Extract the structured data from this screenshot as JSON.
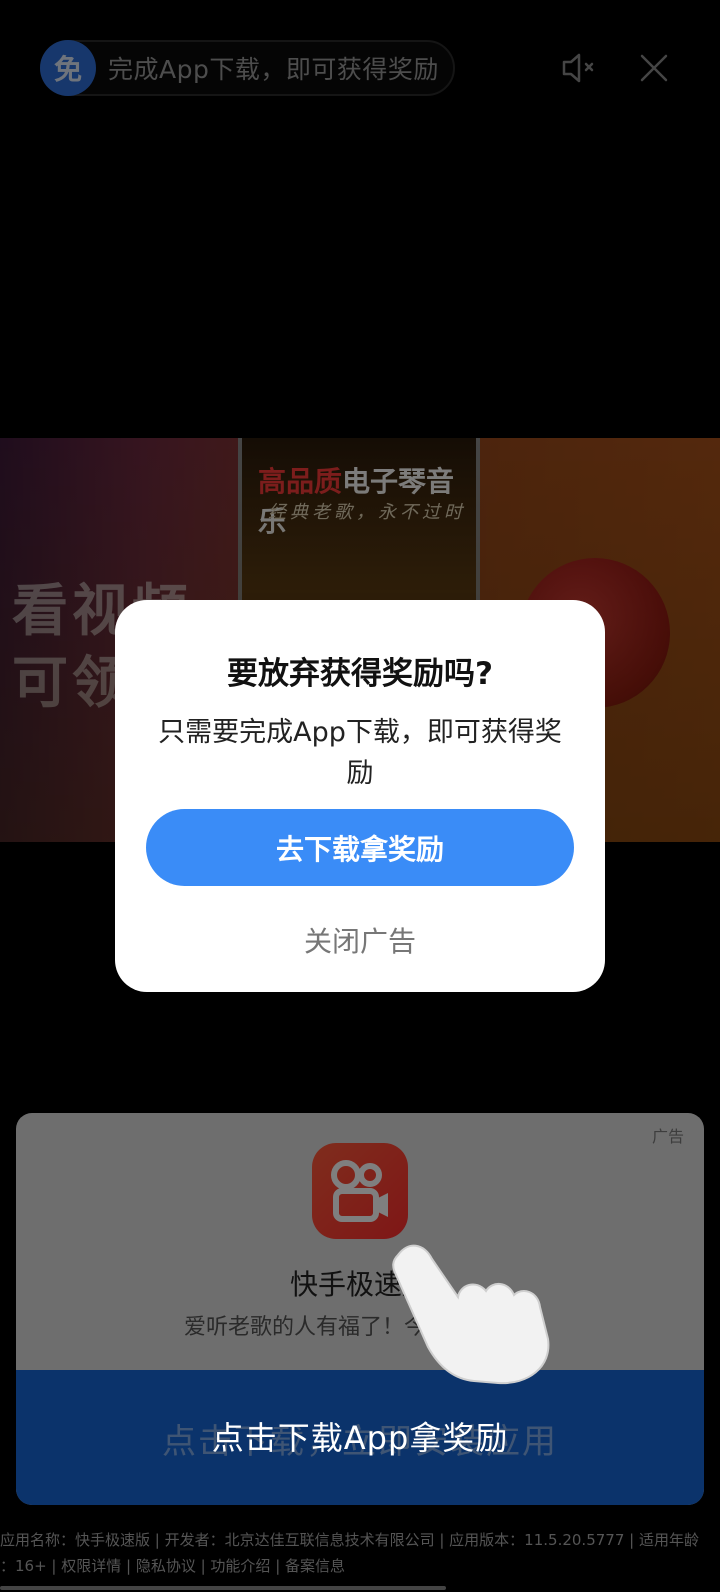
{
  "top_bar": {
    "badge": "免",
    "reward_text": "完成App下载，即可获得奖励",
    "mute_icon": "speaker-muted-icon",
    "close_icon": "close-icon"
  },
  "banner": {
    "left_text_line1": "看视频",
    "left_text_line2": "可领",
    "phone_title_red": "高品质",
    "phone_title_white": "电子琴音乐",
    "phone_subtitle": "经典老歌，永不过时"
  },
  "ad_card": {
    "ad_label": "广告",
    "app_name": "快手极速版",
    "description": "爱听老歌的人有福了！今日…免费听",
    "install_label": "点击下载，立即安装应用"
  },
  "hint_text": "点击下载App拿奖励",
  "footer": {
    "line1": "应用名称：快手极速版 | 开发者：北京达佳互联信息技术有限公司 | 应用版本：11.5.20.5777 | 适用年龄",
    "line2": "：16+ | 权限详情 | 隐私协议 | 功能介绍 | 备案信息"
  },
  "modal": {
    "title": "要放弃获得奖励吗?",
    "body": "只需要完成App下载，即可获得奖励",
    "primary_button": "去下载拿奖励",
    "secondary_button": "关闭广告"
  },
  "colors": {
    "primary": "#3a8cf7",
    "badge": "#2f6ed8",
    "install": "#1767d6"
  }
}
